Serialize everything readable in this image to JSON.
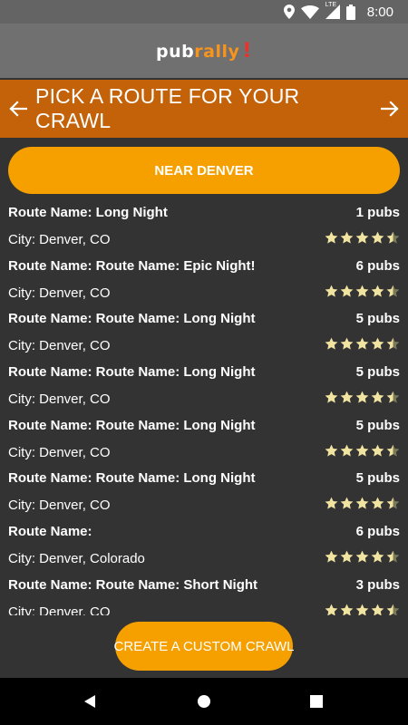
{
  "status_bar": {
    "network": "LTE",
    "time": "8:00",
    "icons": [
      "location-icon",
      "wifi-icon",
      "signal-icon",
      "battery-icon"
    ]
  },
  "app": {
    "logo_part1": "pub",
    "logo_part2": "rally",
    "logo_mark": "!",
    "colors": {
      "brand_orange": "#f7941d",
      "header_bg": "#c4620a",
      "button_bg": "#f6a000",
      "star": "#f1e4a0",
      "star_muted": "#7a7a5a"
    }
  },
  "header": {
    "title": "PICK A ROUTE FOR YOUR CRAWL",
    "left_icon": "arrow-left-icon",
    "right_icon": "arrow-right-icon"
  },
  "near_button": {
    "label": "NEAR DENVER"
  },
  "routes": [
    {
      "name": "Route Name: Long Night",
      "pubs": "1 pubs",
      "city": "City: Denver, CO",
      "rating": 4.5
    },
    {
      "name": "Route Name: Route Name: Epic Night!",
      "pubs": "6 pubs",
      "city": "City: Denver, CO",
      "rating": 4.5
    },
    {
      "name": "Route Name: Route Name: Long Night",
      "pubs": "5 pubs",
      "city": "City: Denver, CO",
      "rating": 4.5
    },
    {
      "name": "Route Name: Route Name: Long Night",
      "pubs": "5 pubs",
      "city": "City: Denver, CO",
      "rating": 4.5
    },
    {
      "name": "Route Name: Route Name: Long Night",
      "pubs": "5 pubs",
      "city": "City: Denver, CO",
      "rating": 4.5
    },
    {
      "name": "Route Name: Route Name: Long Night",
      "pubs": "5 pubs",
      "city": "City: Denver, CO",
      "rating": 4.5
    },
    {
      "name": "Route Name:",
      "pubs": "6 pubs",
      "city": "City: Denver, Colorado",
      "rating": 4.5
    },
    {
      "name": "Route Name: Route Name: Short Night",
      "pubs": "3 pubs",
      "city": "City: Denver, CO",
      "rating": 4.5
    }
  ],
  "create_button": {
    "label": "CREATE A CUSTOM CRAWL"
  },
  "nav_bar": {
    "icons": [
      "back-icon",
      "home-icon",
      "recents-icon"
    ]
  }
}
